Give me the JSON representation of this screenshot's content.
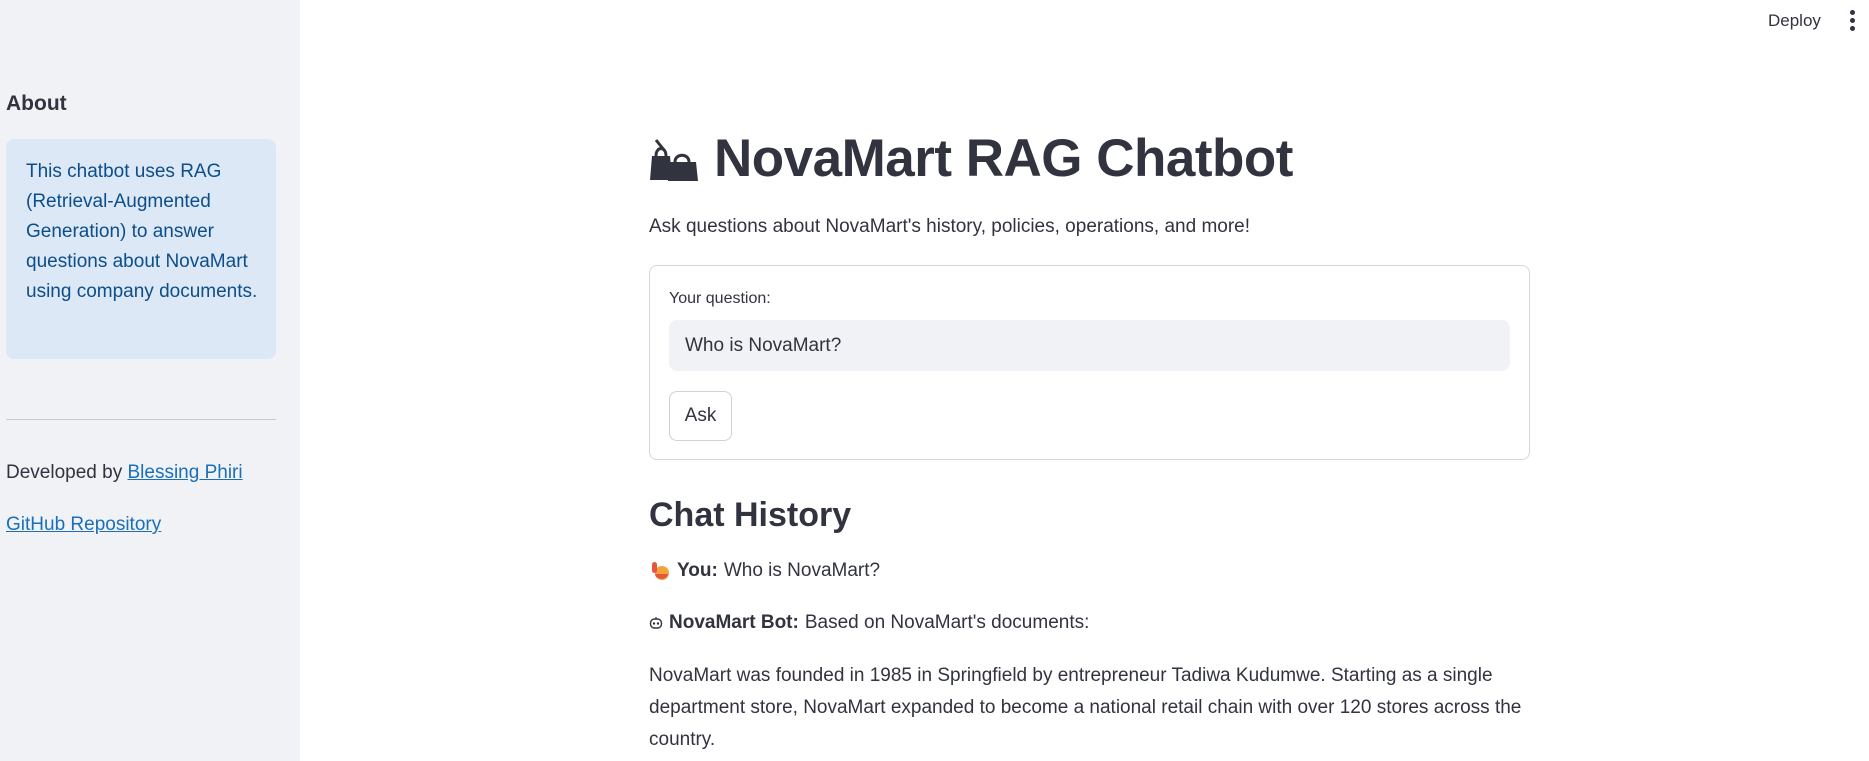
{
  "topbar": {
    "deploy_label": "Deploy",
    "menu_icon": "vertical-ellipsis-icon"
  },
  "sidebar": {
    "heading": "About",
    "info_text": "This chatbot uses RAG (Retrieval-Augmented Generation) to answer questions about NovaMart using company documents.",
    "developed_by_prefix": "Developed by",
    "developer_name": "Blessing Phiri",
    "repo_link": "GitHub Repository"
  },
  "main": {
    "title_icon": "shopping-bags-icon",
    "title": "NovaMart RAG Chatbot",
    "subtitle": "Ask questions about NovaMart's history, policies, operations, and more!",
    "form": {
      "label": "Your question:",
      "question_value": "Who is NovaMart?",
      "ask_label": "Ask"
    },
    "history": {
      "heading": "Chat History",
      "user_icon": "raising-hand-icon",
      "user_label": "You:",
      "user_text": "Who is NovaMart?",
      "bot_icon": "robot-icon",
      "bot_label": "NovaMart Bot:",
      "bot_text": "Based on NovaMart's documents:",
      "answer": "NovaMart was founded in 1985 in Springfield by entrepreneur Tadiwa Kudumwe. Starting as a single department store, NovaMart expanded to become a national retail chain with over 120 stores across the country."
    }
  },
  "colors": {
    "sidebar_bg": "#f0f2f6",
    "info_bg": "#dce8f5",
    "info_text": "#0d4e8a",
    "link": "#1a6fb8",
    "text": "#31333f"
  }
}
